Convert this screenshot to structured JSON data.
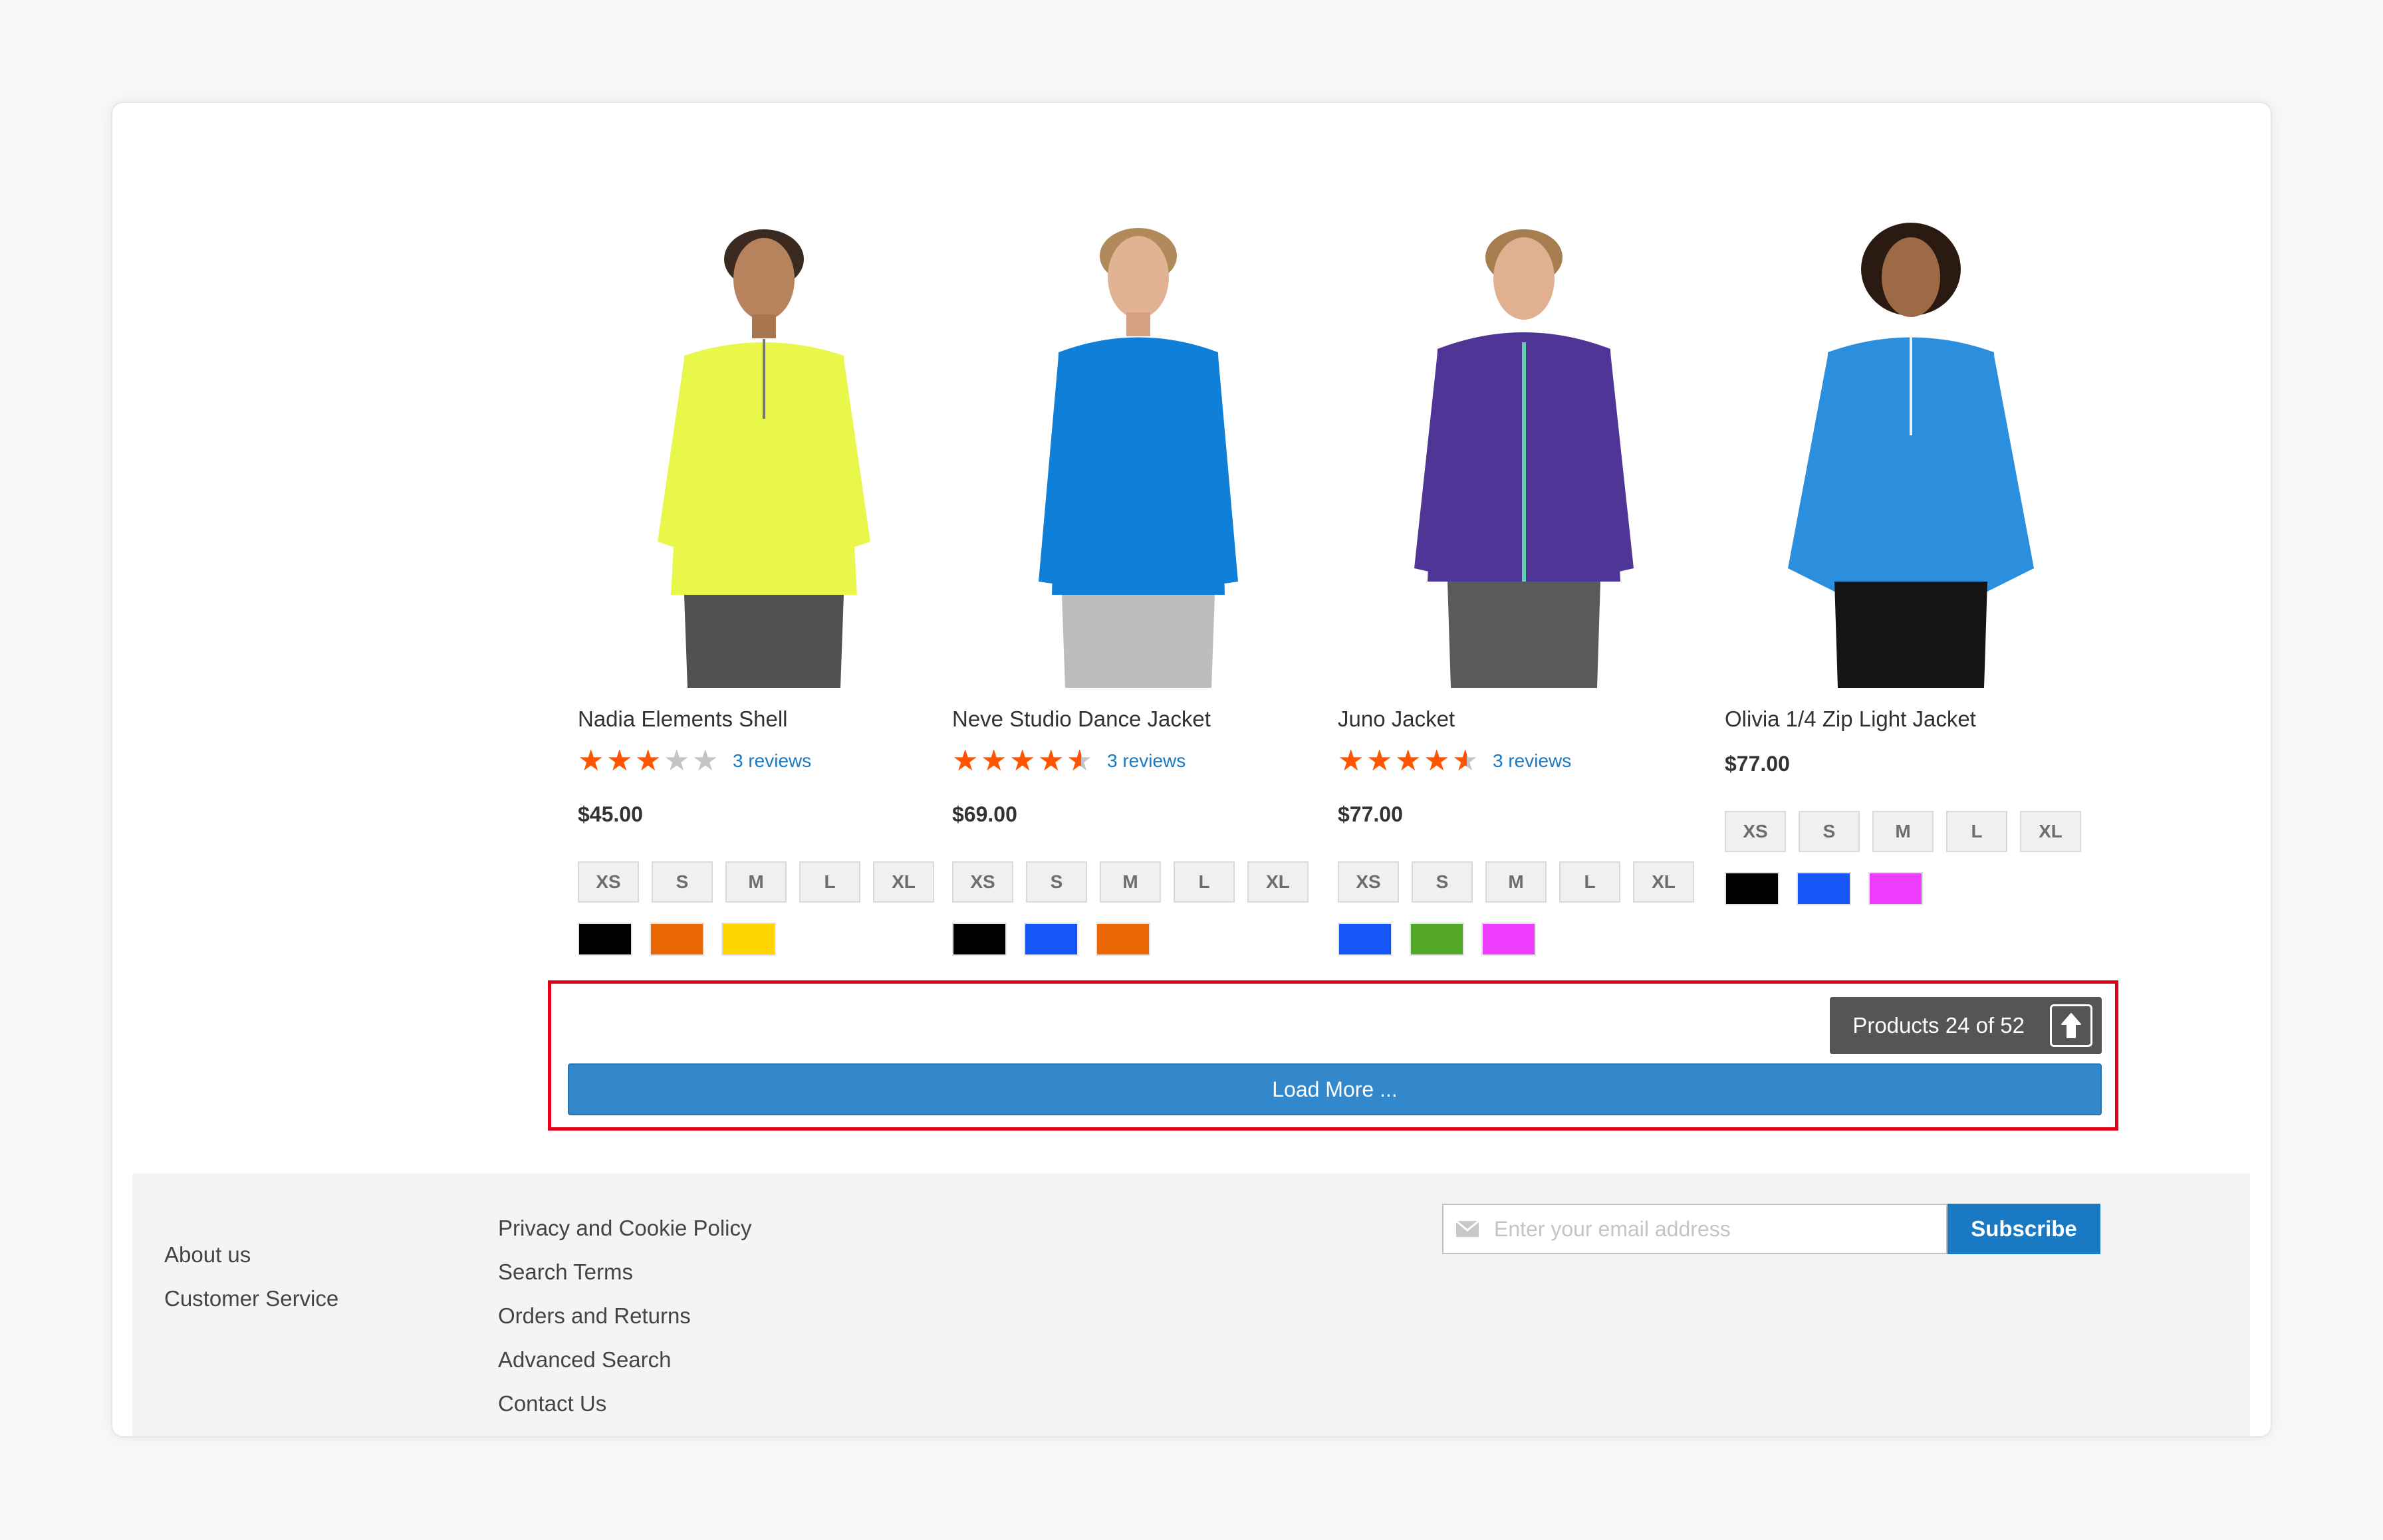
{
  "products": [
    {
      "name": "Nadia Elements Shell",
      "rating": 3,
      "reviews": "3 reviews",
      "price": "$45.00",
      "sizes": [
        "XS",
        "S",
        "M",
        "L",
        "XL"
      ],
      "colors": [
        "#000000",
        "#eb6703",
        "#ffd500"
      ],
      "garment_color": "#e8f74a",
      "pants_color": "#505050"
    },
    {
      "name": "Neve Studio Dance Jacket",
      "rating": 4.5,
      "reviews": "3 reviews",
      "price": "$69.00",
      "sizes": [
        "XS",
        "S",
        "M",
        "L",
        "XL"
      ],
      "colors": [
        "#000000",
        "#1857f7",
        "#eb6703"
      ],
      "garment_color": "#0f7fd8",
      "pants_color": "#bdbdbd"
    },
    {
      "name": "Juno Jacket",
      "rating": 4.5,
      "reviews": "3 reviews",
      "price": "$77.00",
      "sizes": [
        "XS",
        "S",
        "M",
        "L",
        "XL"
      ],
      "colors": [
        "#1857f7",
        "#53a828",
        "#ef3dff"
      ],
      "garment_color": "#4f3596",
      "pants_color": "#5a5a5a"
    },
    {
      "name": "Olivia 1/4 Zip Light Jacket",
      "rating": null,
      "reviews": "",
      "price": "$77.00",
      "sizes": [
        "XS",
        "S",
        "M",
        "L",
        "XL"
      ],
      "colors": [
        "#000000",
        "#1857f7",
        "#ef3dff"
      ],
      "garment_color": "#2c8fde",
      "pants_color": "#151515"
    }
  ],
  "pager": {
    "products_count": "Products 24 of 52",
    "load_more_label": "Load More ..."
  },
  "footer": {
    "col1": [
      "About us",
      "Customer Service"
    ],
    "col2": [
      "Privacy and Cookie Policy",
      "Search Terms",
      "Orders and Returns",
      "Advanced Search",
      "Contact Us"
    ],
    "newsletter": {
      "placeholder": "Enter your email address",
      "value": "",
      "subscribe_label": "Subscribe"
    }
  },
  "colors": {
    "accent": "#1979c3",
    "load_more": "#3388cc",
    "star": "#ff5501",
    "highlight": "#e2001a"
  }
}
